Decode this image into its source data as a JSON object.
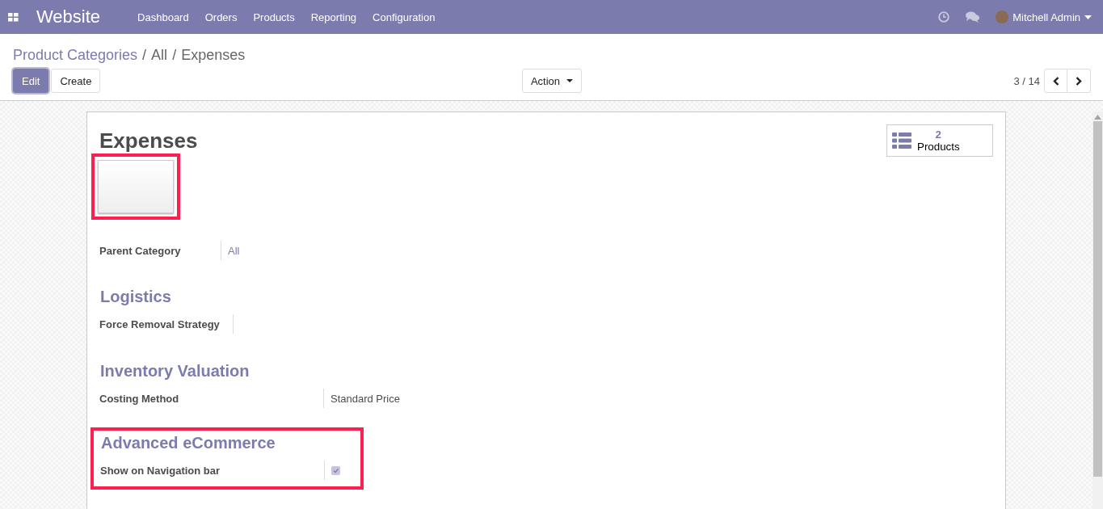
{
  "navbar": {
    "app_title": "Website",
    "menus": [
      "Dashboard",
      "Orders",
      "Products",
      "Reporting",
      "Configuration"
    ],
    "user_name": "Mitchell Admin"
  },
  "breadcrumbs": [
    {
      "kind": "link",
      "text": "Product Categories"
    },
    {
      "kind": "separator",
      "text": "/"
    },
    {
      "kind": "plain",
      "text": "All"
    },
    {
      "kind": "separator",
      "text": "/"
    },
    {
      "kind": "plain",
      "text": "Expenses"
    }
  ],
  "buttons": [
    {
      "label": "Edit",
      "kind": "primary"
    },
    {
      "label": "Create",
      "kind": "secondary"
    }
  ],
  "action_menu": {
    "label": "Action"
  },
  "pager": {
    "text": "3 / 14"
  },
  "sheet": {
    "title": "Expenses",
    "image": {
      "highlighted": true
    },
    "smart_button": {
      "count": "2",
      "label": "Products"
    },
    "sections": [
      {
        "highlighted": false,
        "fields": [
          {
            "label": "Parent Category",
            "kind": "link",
            "value": "All"
          }
        ]
      },
      {
        "heading": "Logistics",
        "highlighted": false,
        "fields": [
          {
            "label": "Force Removal Strategy",
            "kind": "text"
          }
        ]
      },
      {
        "heading": "Inventory Valuation",
        "highlighted": false,
        "fields": [
          {
            "label": "Costing Method",
            "kind": "text",
            "value": "Standard Price"
          }
        ]
      },
      {
        "heading": "Advanced eCommerce",
        "highlighted": true,
        "fields": [
          {
            "label": "Show on Navigation bar",
            "kind": "checkbox",
            "checked": true
          }
        ]
      }
    ]
  }
}
